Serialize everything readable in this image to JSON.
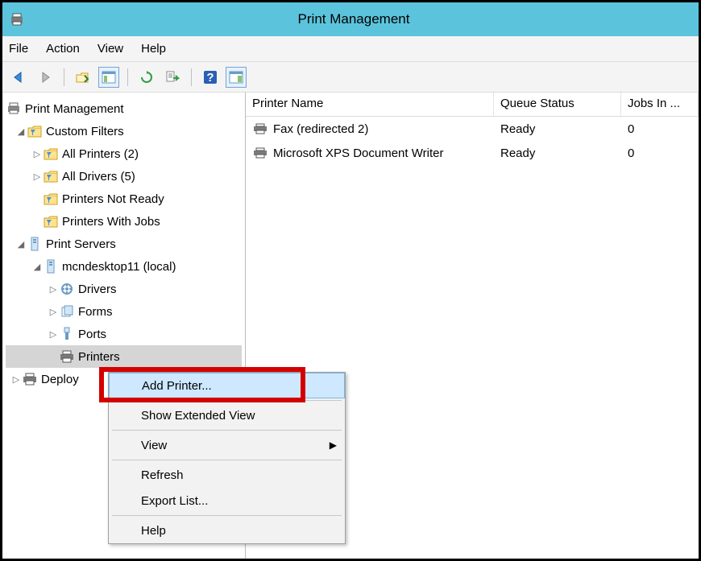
{
  "window": {
    "title": "Print Management"
  },
  "menubar": {
    "file": "File",
    "action": "Action",
    "view": "View",
    "help": "Help"
  },
  "tree": {
    "root": "Print Management",
    "customFilters": "Custom Filters",
    "allPrinters": "All Printers (2)",
    "allDrivers": "All Drivers (5)",
    "notReady": "Printers Not Ready",
    "withJobs": "Printers With Jobs",
    "printServers": "Print Servers",
    "server": "mcndesktop11 (local)",
    "drivers": "Drivers",
    "forms": "Forms",
    "ports": "Ports",
    "printers": "Printers",
    "deployed": "Deploy"
  },
  "columns": {
    "name": "Printer Name",
    "status": "Queue Status",
    "jobs": "Jobs In ..."
  },
  "rows": [
    {
      "name": "Fax (redirected 2)",
      "status": "Ready",
      "jobs": "0"
    },
    {
      "name": "Microsoft XPS Document Writer",
      "status": "Ready",
      "jobs": "0"
    }
  ],
  "context": {
    "addPrinter": "Add Printer...",
    "showExtended": "Show Extended View",
    "view": "View",
    "refresh": "Refresh",
    "exportList": "Export List...",
    "help": "Help"
  }
}
